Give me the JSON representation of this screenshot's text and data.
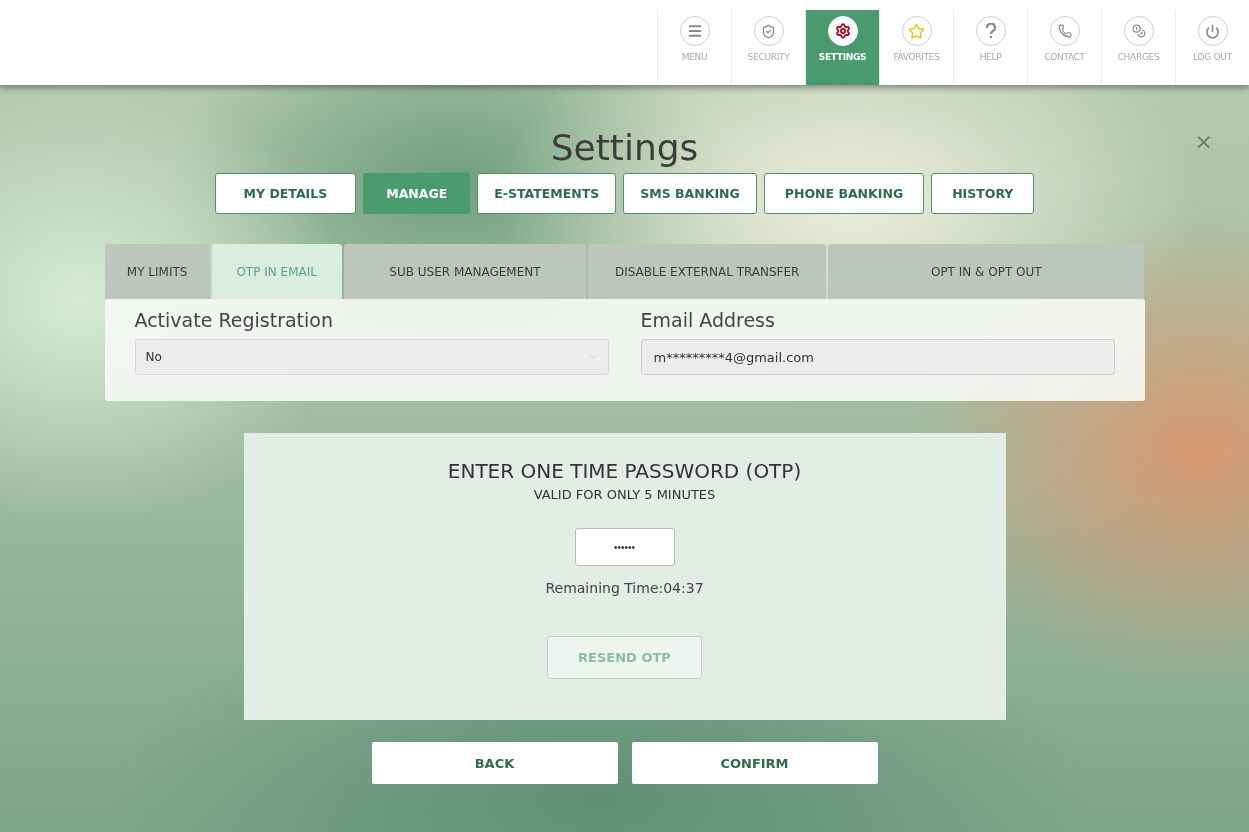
{
  "top_nav": [
    {
      "label": "MENU",
      "selected": false
    },
    {
      "label": "SECURITY",
      "selected": false
    },
    {
      "label": "SETTINGS",
      "selected": true
    },
    {
      "label": "FAVORITES",
      "selected": false
    },
    {
      "label": "HELP",
      "selected": false
    },
    {
      "label": "CONTACT",
      "selected": false
    },
    {
      "label": "CHARGES",
      "selected": false
    },
    {
      "label": "LOG OUT",
      "selected": false
    }
  ],
  "close": "×",
  "title": "Settings",
  "tabs": [
    {
      "label": "MY DETAILS",
      "selected": false
    },
    {
      "label": "MANAGE",
      "selected": true
    },
    {
      "label": "E-STATEMENTS",
      "selected": false
    },
    {
      "label": "SMS BANKING",
      "selected": false
    },
    {
      "label": "PHONE BANKING",
      "selected": false
    },
    {
      "label": "HISTORY",
      "selected": false
    }
  ],
  "sub_tabs": [
    {
      "label": "MY LIMITS",
      "selected": false
    },
    {
      "label": "OTP IN EMAIL",
      "selected": true
    },
    {
      "label": "SUB USER MANAGEMENT",
      "selected": false
    },
    {
      "label": "DISABLE EXTERNAL TRANSFER",
      "selected": false
    },
    {
      "label": "OPT IN & OPT OUT",
      "selected": false
    }
  ],
  "form": {
    "activate_label": "Activate Registration",
    "activate_value": "No",
    "email_label": "Email Address",
    "email_value": "m*********4@gmail.com"
  },
  "otp": {
    "heading": "ENTER ONE TIME PASSWORD (OTP)",
    "subheading": "VALID FOR ONLY 5 MINUTES",
    "value": "••••••",
    "remaining": "Remaining Time:04:37",
    "resend": "RESEND OTP",
    "resend_disabled": true
  },
  "buttons": [
    "BACK",
    "CONFIRM"
  ]
}
